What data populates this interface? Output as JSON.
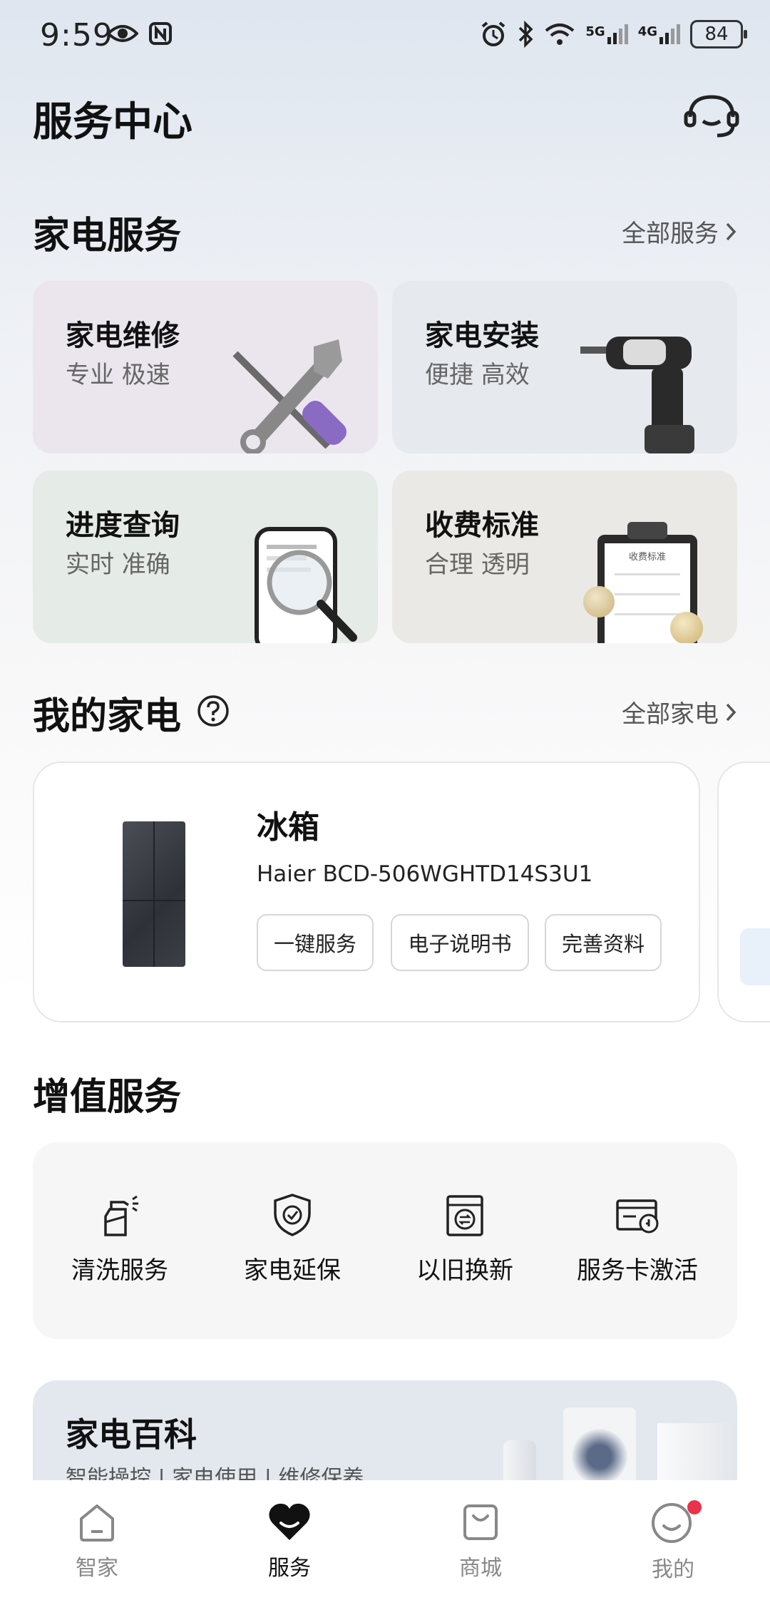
{
  "status_bar": {
    "time": "9:59",
    "signal_5g": "5G",
    "signal_4g": "4G",
    "battery": "84"
  },
  "header": {
    "title": "服务中心"
  },
  "appliance_services": {
    "title": "家电服务",
    "all_link": "全部服务",
    "cards": [
      {
        "title": "家电维修",
        "subtitle": "专业 极速",
        "bg": "#ebe6ee"
      },
      {
        "title": "家电安装",
        "subtitle": "便捷 高效",
        "bg": "#e6e9ee"
      },
      {
        "title": "进度查询",
        "subtitle": "实时 准确",
        "bg": "#e5ebe6"
      },
      {
        "title": "收费标准",
        "subtitle": "合理 透明",
        "bg": "#ebe9e5"
      }
    ],
    "fee_doc_title": "收费标准"
  },
  "my_appliances": {
    "title": "我的家电",
    "all_link": "全部家电",
    "item": {
      "name": "冰箱",
      "model": "Haier BCD-506WGHTD14S3U1",
      "buttons": [
        "一键服务",
        "电子说明书",
        "完善资料"
      ]
    }
  },
  "value_added": {
    "title": "增值服务",
    "items": [
      {
        "label": "清洗服务",
        "icon": "spray-bottle-icon"
      },
      {
        "label": "家电延保",
        "icon": "shield-check-icon"
      },
      {
        "label": "以旧换新",
        "icon": "exchange-machine-icon"
      },
      {
        "label": "服务卡激活",
        "icon": "service-card-icon"
      }
    ]
  },
  "encyclopedia": {
    "title": "家电百科",
    "subtitle": "智能操控 | 家电使用 | 维修保养"
  },
  "bottom_nav": {
    "items": [
      {
        "label": "智家",
        "active": false
      },
      {
        "label": "服务",
        "active": true
      },
      {
        "label": "商城",
        "active": false
      },
      {
        "label": "我的",
        "active": false
      }
    ]
  },
  "colors": {
    "accent_red": "#e8334a",
    "text_primary": "#111111",
    "text_secondary": "#666666"
  }
}
